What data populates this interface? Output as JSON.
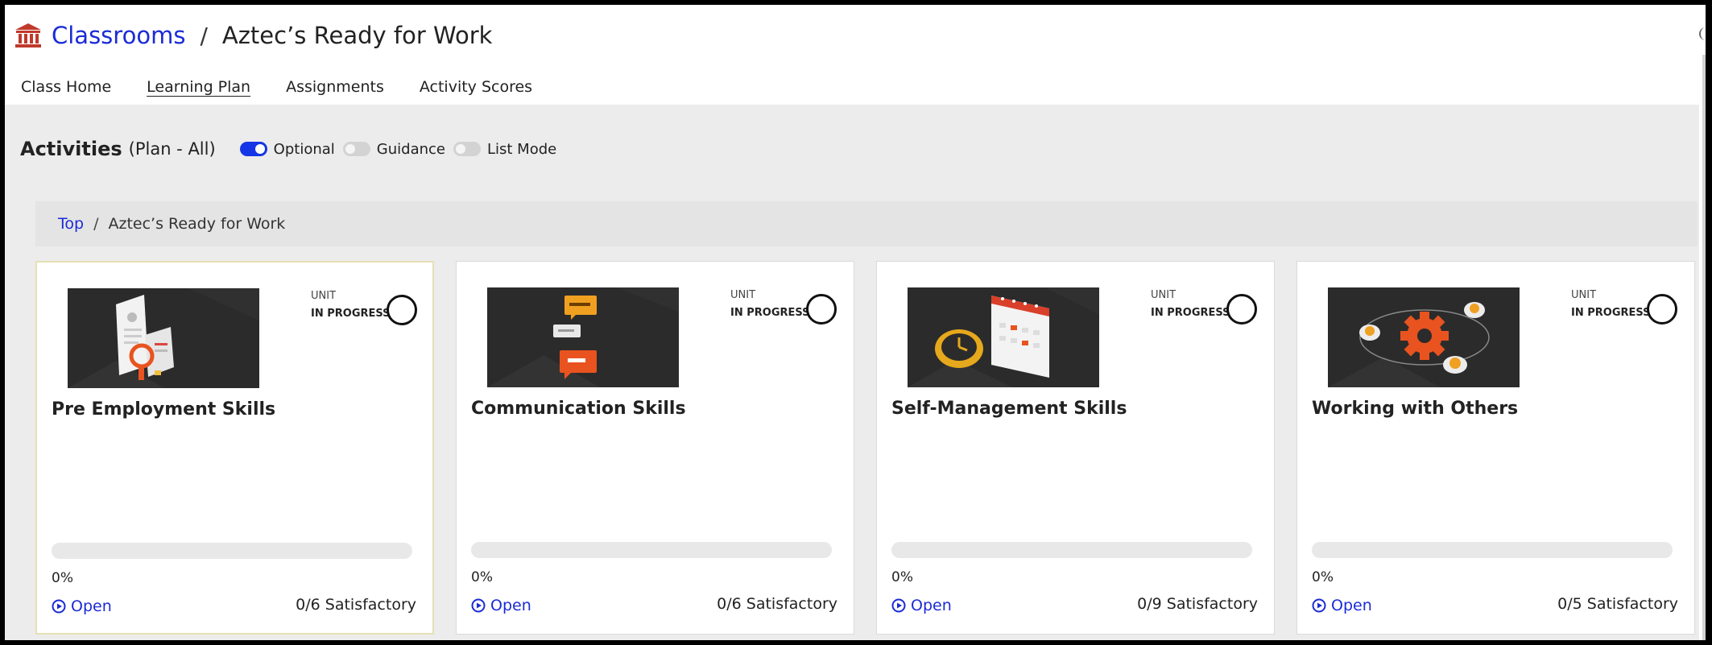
{
  "breadcrumb": {
    "root_label": "Classrooms",
    "separator": "/",
    "current": "Aztec’s Ready for Work",
    "icon": "bank-icon"
  },
  "tabs": [
    {
      "label": "Class Home",
      "active": false
    },
    {
      "label": "Learning Plan",
      "active": true
    },
    {
      "label": "Assignments",
      "active": false
    },
    {
      "label": "Activity Scores",
      "active": false
    }
  ],
  "activities": {
    "title": "Activities",
    "subtitle": "(Plan - All)",
    "toggles": [
      {
        "label": "Optional",
        "on": true
      },
      {
        "label": "Guidance",
        "on": false
      },
      {
        "label": "List Mode",
        "on": false
      }
    ]
  },
  "path": {
    "top_label": "Top",
    "separator": "/",
    "current": "Aztec’s Ready for Work"
  },
  "cards": [
    {
      "title": "Pre Employment Skills",
      "unit_label": "UNIT",
      "status": "IN PROGRESS",
      "percent_label": "0%",
      "progress": 0,
      "open_label": "Open",
      "satisfactory": "0/6 Satisfactory",
      "thumb_icon": "resume-magnifier-icon"
    },
    {
      "title": "Communication Skills",
      "unit_label": "UNIT",
      "status": "IN PROGRESS",
      "percent_label": "0%",
      "progress": 0,
      "open_label": "Open",
      "satisfactory": "0/6 Satisfactory",
      "thumb_icon": "speech-bubbles-icon"
    },
    {
      "title": "Self-Management Skills",
      "unit_label": "UNIT",
      "status": "IN PROGRESS",
      "percent_label": "0%",
      "progress": 0,
      "open_label": "Open",
      "satisfactory": "0/9 Satisfactory",
      "thumb_icon": "calendar-clock-icon"
    },
    {
      "title": "Working with Others",
      "unit_label": "UNIT",
      "status": "IN PROGRESS",
      "percent_label": "0%",
      "progress": 0,
      "open_label": "Open",
      "satisfactory": "0/5 Satisfactory",
      "thumb_icon": "gear-network-icon"
    }
  ],
  "colors": {
    "link": "#1b2bd6",
    "toggle_on": "#1436e6",
    "toggle_off": "#d3d3d3",
    "page_grey": "#ececec",
    "thumb_bg": "#2b2b2b",
    "accent_orange": "#e8531f",
    "bank_red": "#c0392b",
    "selected_border": "#e6e0b4"
  }
}
